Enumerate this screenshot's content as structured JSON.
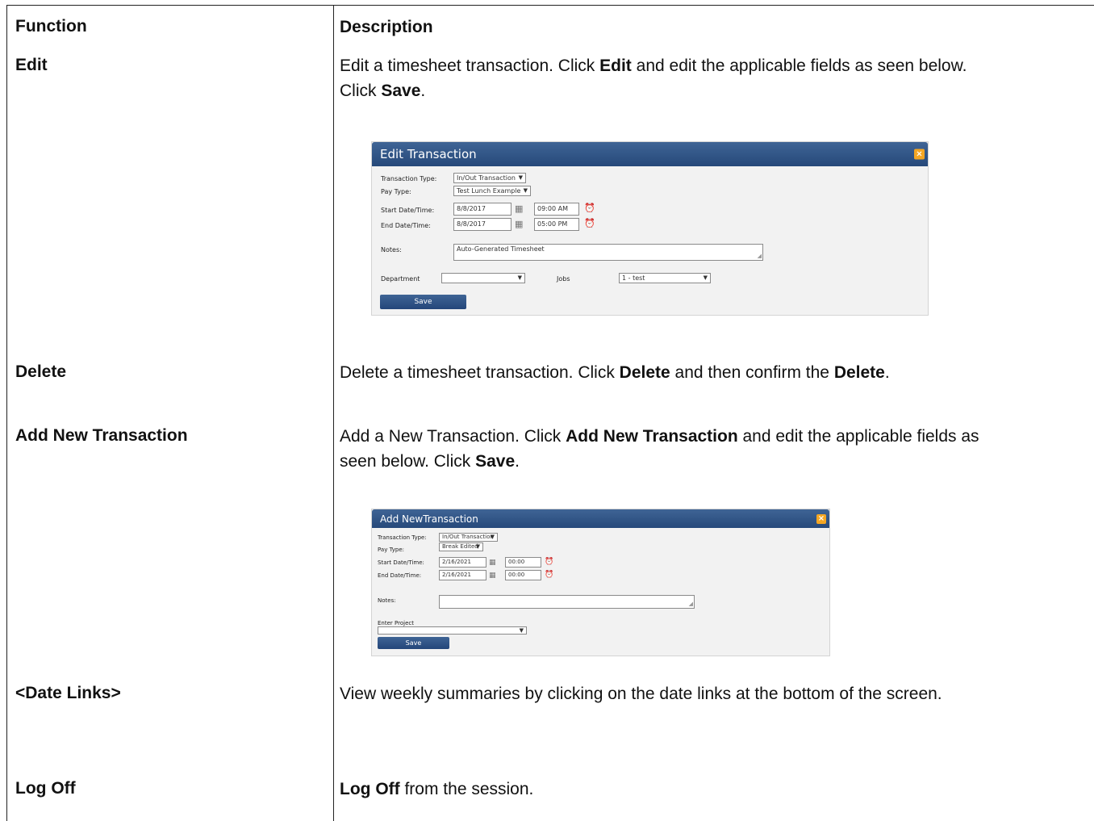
{
  "table": {
    "header": {
      "function": "Function",
      "description": "Description"
    },
    "rows": [
      {
        "function": "Edit",
        "desc_1": "Edit a timesheet transaction. Click ",
        "desc_b1": "Edit",
        "desc_2": " and edit the applicable fields as seen below.",
        "desc_3": "Click ",
        "desc_b2": "Save",
        "desc_4": "."
      },
      {
        "function": "Delete",
        "desc_1": "Delete a timesheet transaction. Click ",
        "desc_b1": "Delete",
        "desc_2": " and then confirm the ",
        "desc_b2": "Delete",
        "desc_3": "."
      },
      {
        "function": "Add New Transaction",
        "desc_1": "Add a New Transaction. Click ",
        "desc_b1": "Add New Transaction",
        "desc_2": " and edit the applicable fields as",
        "desc_3": "seen below. Click ",
        "desc_b2": "Save",
        "desc_4": "."
      },
      {
        "function": "<Date Links>",
        "desc_1": "View weekly summaries by clicking on the date links at the bottom of the screen."
      },
      {
        "function": "Log Off",
        "desc_b1": "Log Off",
        "desc_1": " from the session."
      }
    ]
  },
  "edit_dialog": {
    "title": "Edit Transaction",
    "close_icon": "close-x",
    "transaction_type_label": "Transaction Type:",
    "transaction_type_value": "In/Out Transaction",
    "pay_type_label": "Pay Type:",
    "pay_type_value": "Test Lunch Example",
    "start_label": "Start Date/Time:",
    "start_date": "8/8/2017",
    "start_time": "09:00 AM",
    "end_label": "End Date/Time:",
    "end_date": "8/8/2017",
    "end_time": "05:00 PM",
    "notes_label": "Notes:",
    "notes_value": "Auto-Generated Timesheet",
    "department_label": "Department",
    "department_value": "",
    "jobs_label": "Jobs",
    "jobs_value": "1 - test",
    "save_label": "Save"
  },
  "add_dialog": {
    "title": "Add NewTransaction",
    "close_icon": "close-x",
    "transaction_type_label": "Transaction Type:",
    "transaction_type_value": "In/Out Transaction",
    "pay_type_label": "Pay Type:",
    "pay_type_value": "Break Edited",
    "start_label": "Start Date/Time:",
    "start_date": "2/16/2021",
    "start_time": "00:00",
    "end_label": "End Date/Time:",
    "end_date": "2/16/2021",
    "end_time": "00:00",
    "notes_label": "Notes:",
    "notes_value": "",
    "project_label": "Enter Project",
    "project_value": "",
    "save_label": "Save"
  }
}
